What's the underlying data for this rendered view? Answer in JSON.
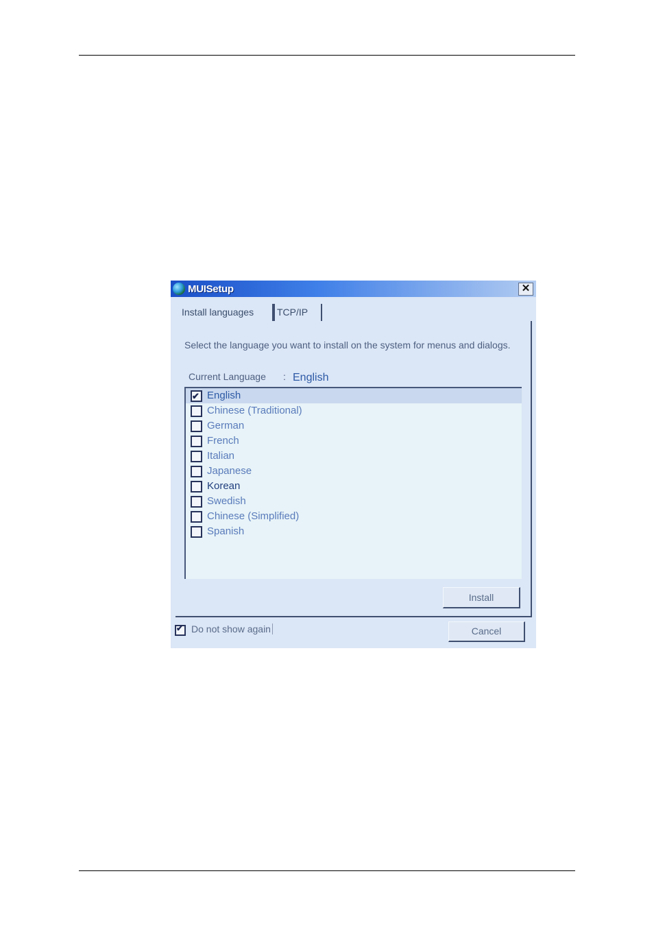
{
  "window": {
    "title": "MUISetup",
    "close_label": "✕"
  },
  "tabs": [
    {
      "label": "Install languages"
    },
    {
      "label": "TCP/IP"
    }
  ],
  "panel": {
    "description": "Select the language you want to install on the system for menus and dialogs.",
    "current_language_label": "Current Language",
    "current_language_separator": ":",
    "current_language_value": "English"
  },
  "languages": [
    {
      "label": "English",
      "checked": true
    },
    {
      "label": "Chinese (Traditional)",
      "checked": false
    },
    {
      "label": "German",
      "checked": false
    },
    {
      "label": "French",
      "checked": false
    },
    {
      "label": "Italian",
      "checked": false
    },
    {
      "label": "Japanese",
      "checked": false
    },
    {
      "label": "Korean",
      "checked": false
    },
    {
      "label": "Swedish",
      "checked": false
    },
    {
      "label": "Chinese (Simplified)",
      "checked": false
    },
    {
      "label": "Spanish",
      "checked": false
    }
  ],
  "buttons": {
    "install_label": "Install",
    "cancel_label": "Cancel"
  },
  "footer": {
    "do_not_show_label": "Do not show again",
    "do_not_show_checked": true
  },
  "icons": {
    "window_icon": "globe-icon",
    "check_mark": "✔"
  }
}
